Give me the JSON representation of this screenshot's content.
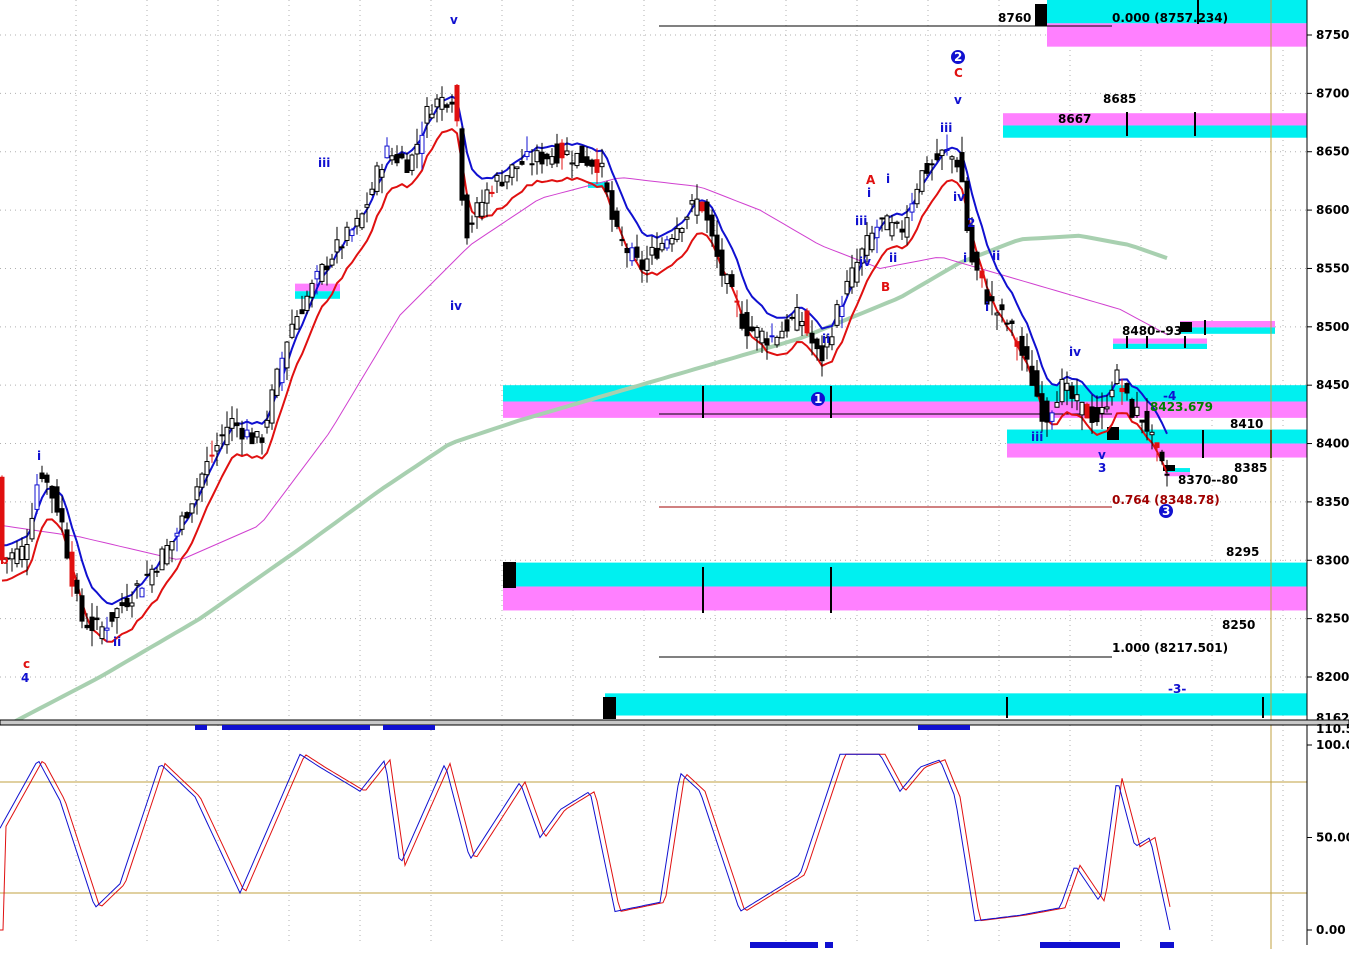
{
  "colors": {
    "cyan": "#00f0f0",
    "magenta": "#ff80ff",
    "blue": "#1010d0",
    "red": "#e01010",
    "green_ma": "#a8d0b0",
    "purple_ma": "#d040d0",
    "dark_red": "#a00000",
    "dark_green": "#008000",
    "olive": "#c0a040"
  },
  "chart_data": [
    {
      "type": "candlestick",
      "panel": "price",
      "ylim": [
        8162,
        8780
      ],
      "y_ticks": [
        "8750.",
        "8700.",
        "8650.",
        "8600.",
        "8550.",
        "8500.",
        "8450.",
        "8400.",
        "8350.",
        "8300.",
        "8250.",
        "8200."
      ],
      "y_tick_values": [
        8750,
        8700,
        8650,
        8600,
        8550,
        8500,
        8450,
        8400,
        8350,
        8300,
        8250,
        8200
      ],
      "last_value_label": "8162.5",
      "grid": true,
      "price_levels": [
        {
          "label": "8760"
        },
        {
          "label": "0.000 (8757.234)"
        },
        {
          "label": "8685"
        },
        {
          "label": "8667"
        },
        {
          "label": "8480--93"
        },
        {
          "label": "8423.679"
        },
        {
          "label": "8410"
        },
        {
          "label": "8385"
        },
        {
          "label": "8370--80"
        },
        {
          "label": "0.764 (8348.78)"
        },
        {
          "label": "8295"
        },
        {
          "label": "8250"
        },
        {
          "label": "1.000 (8217.501)"
        },
        {
          "label": "-3-"
        },
        {
          "label": "-4"
        }
      ],
      "zones": [
        {
          "price_top": 8780,
          "price_bottom": 8740,
          "colors": "cyan-magenta"
        },
        {
          "price_top": 8683,
          "price_bottom": 8662,
          "colors": "magenta-cyan"
        },
        {
          "price_top": 8505,
          "price_bottom": 8494,
          "colors": "magenta-cyan"
        },
        {
          "price_top": 8490,
          "price_bottom": 8481,
          "colors": "magenta-cyan"
        },
        {
          "price_top": 8450,
          "price_bottom": 8422,
          "colors": "cyan-magenta"
        },
        {
          "price_top": 8412,
          "price_bottom": 8388,
          "colors": "cyan-magenta"
        },
        {
          "price_top": 8379,
          "price_bottom": 8372,
          "colors": "cyan-magenta"
        },
        {
          "price_top": 8298,
          "price_bottom": 8257,
          "colors": "cyan-magenta"
        },
        {
          "price_top": 8186,
          "price_bottom": 8167,
          "colors": "cyan"
        },
        {
          "price_top": 8537,
          "price_bottom": 8524,
          "colors": "magenta-cyan"
        },
        {
          "price_top": 8624,
          "price_bottom": 8619,
          "colors": "cyan"
        }
      ],
      "wave_labels": [
        {
          "text": "b",
          "color": "red"
        },
        {
          "text": "c",
          "color": "red"
        },
        {
          "text": "4",
          "color": "blue"
        },
        {
          "text": "i",
          "color": "blue"
        },
        {
          "text": "ii",
          "color": "blue"
        },
        {
          "text": "iii",
          "color": "blue"
        },
        {
          "text": "iv",
          "color": "blue"
        },
        {
          "text": "v",
          "color": "blue"
        },
        {
          "text": "A",
          "color": "red"
        },
        {
          "text": "B",
          "color": "red"
        },
        {
          "text": "C",
          "color": "red"
        },
        {
          "text": "1",
          "color": "blue"
        },
        {
          "text": "2",
          "color": "blue"
        },
        {
          "text": "3",
          "color": "blue"
        }
      ],
      "ma_series": [
        {
          "color": "green_ma"
        },
        {
          "color": "purple_ma"
        },
        {
          "color": "blue"
        },
        {
          "color": "red"
        }
      ]
    },
    {
      "type": "line",
      "panel": "oscillator",
      "ylim": [
        0,
        100
      ],
      "y_ticks": [
        "100.0",
        "50.00",
        "0.00"
      ],
      "y_tick_values": [
        100,
        50,
        0
      ],
      "header_value": "110.5",
      "reference_lines": [
        80,
        20
      ],
      "series": [
        {
          "color": "blue"
        },
        {
          "color": "red"
        }
      ]
    }
  ]
}
